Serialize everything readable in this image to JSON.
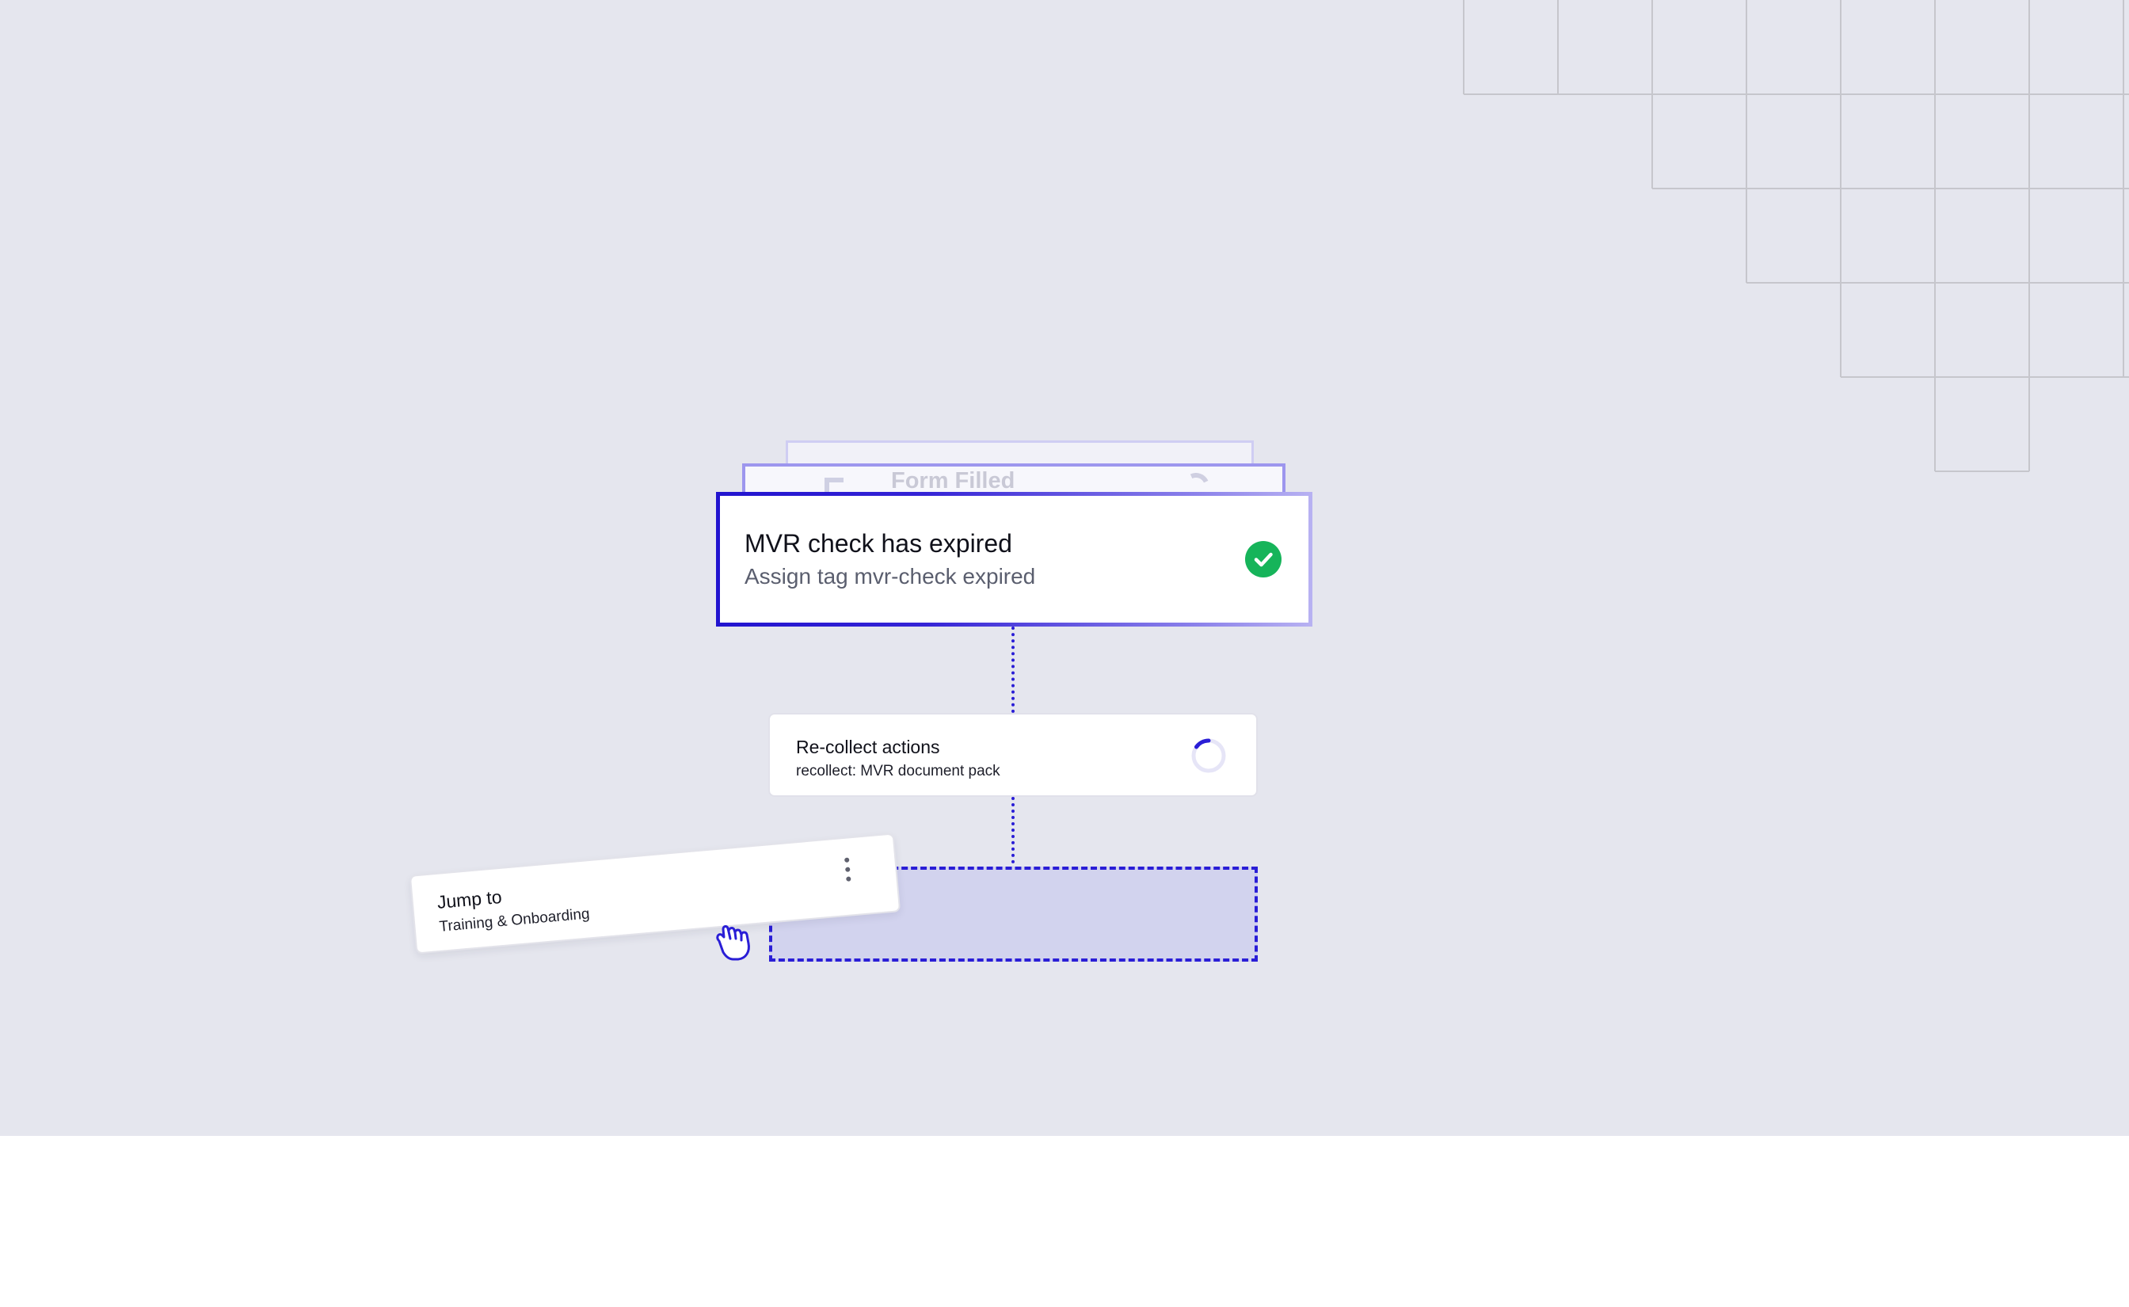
{
  "colors": {
    "canvas_background": "#e5e6ee",
    "accent": "#2a1ed6",
    "success": "#16b45a",
    "drop_zone_fill": "#d2d3ee",
    "grid_line": "#c6c6cc"
  },
  "background_stack": {
    "label": "Form Filled"
  },
  "trigger_card": {
    "title": "MVR check has expired",
    "subtitle": "Assign tag mvr-check expired",
    "status_icon": "check-circle-icon",
    "status": "completed"
  },
  "action_card": {
    "title": "Re-collect actions",
    "subtitle": "recollect: MVR document pack",
    "status_icon": "spinner-icon",
    "status": "loading"
  },
  "dragged_card": {
    "title": "Jump to",
    "subtitle": "Training & Onboarding",
    "menu_icon": "kebab-menu-icon"
  },
  "cursor": {
    "icon": "grab-hand-icon"
  }
}
